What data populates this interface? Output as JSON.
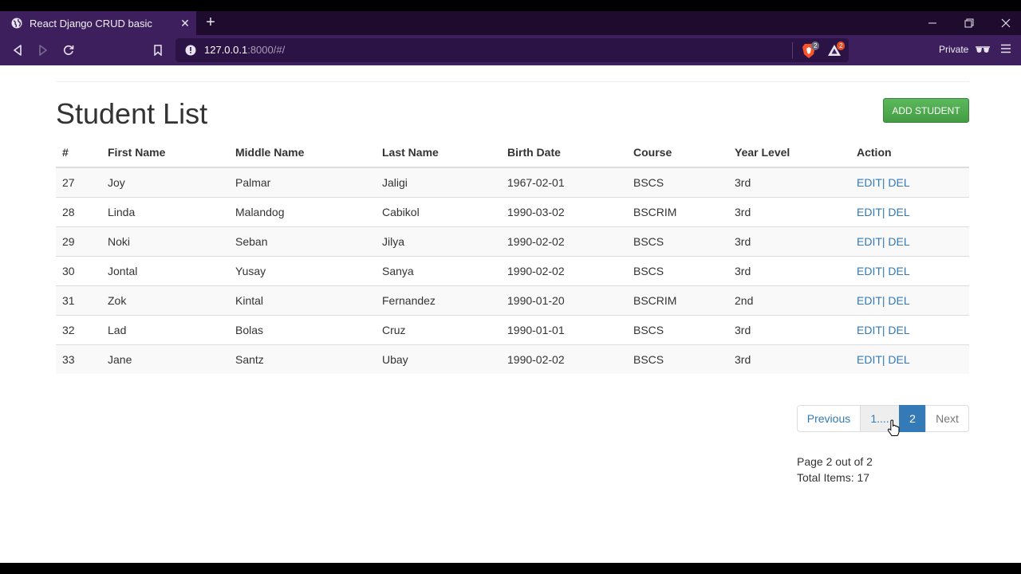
{
  "browser": {
    "tab_title": "React Django CRUD basic",
    "url_host": "127.0.0.1",
    "url_rest": ":8000/#/",
    "shield_count": "2",
    "rewards_count": "2",
    "private_label": "Private",
    "colors": {
      "tab_active": "#3c1f5c",
      "tabstrip": "#1e0b2e",
      "urlbar": "#2c1346"
    }
  },
  "page": {
    "title": "Student List",
    "add_button": "ADD STUDENT",
    "table": {
      "headers": [
        "#",
        "First Name",
        "Middle Name",
        "Last Name",
        "Birth Date",
        "Course",
        "Year Level",
        "Action"
      ],
      "rows": [
        {
          "id": "27",
          "first": "Joy",
          "middle": "Palmar",
          "last": "Jaligi",
          "birth": "1967-02-01",
          "course": "BSCS",
          "year": "3rd"
        },
        {
          "id": "28",
          "first": "Linda",
          "middle": "Malandog",
          "last": "Cabikol",
          "birth": "1990-03-02",
          "course": "BSCRIM",
          "year": "3rd"
        },
        {
          "id": "29",
          "first": "Noki",
          "middle": "Seban",
          "last": "Jilya",
          "birth": "1990-02-02",
          "course": "BSCS",
          "year": "3rd"
        },
        {
          "id": "30",
          "first": "Jontal",
          "middle": "Yusay",
          "last": "Sanya",
          "birth": "1990-02-02",
          "course": "BSCS",
          "year": "3rd"
        },
        {
          "id": "31",
          "first": "Zok",
          "middle": "Kintal",
          "last": "Fernandez",
          "birth": "1990-01-20",
          "course": "BSCRIM",
          "year": "2nd"
        },
        {
          "id": "32",
          "first": "Lad",
          "middle": "Bolas",
          "last": "Cruz",
          "birth": "1990-01-01",
          "course": "BSCS",
          "year": "3rd"
        },
        {
          "id": "33",
          "first": "Jane",
          "middle": "Santz",
          "last": "Ubay",
          "birth": "1990-02-02",
          "course": "BSCS",
          "year": "3rd"
        }
      ],
      "edit_label": "EDIT",
      "separator": "|",
      "del_label": " DEL"
    },
    "pagination": {
      "previous": "Previous",
      "ellipsis": "1....",
      "current": "2",
      "next": "Next"
    },
    "page_info": "Page 2 out of 2",
    "total_items": "Total Items: 17"
  }
}
